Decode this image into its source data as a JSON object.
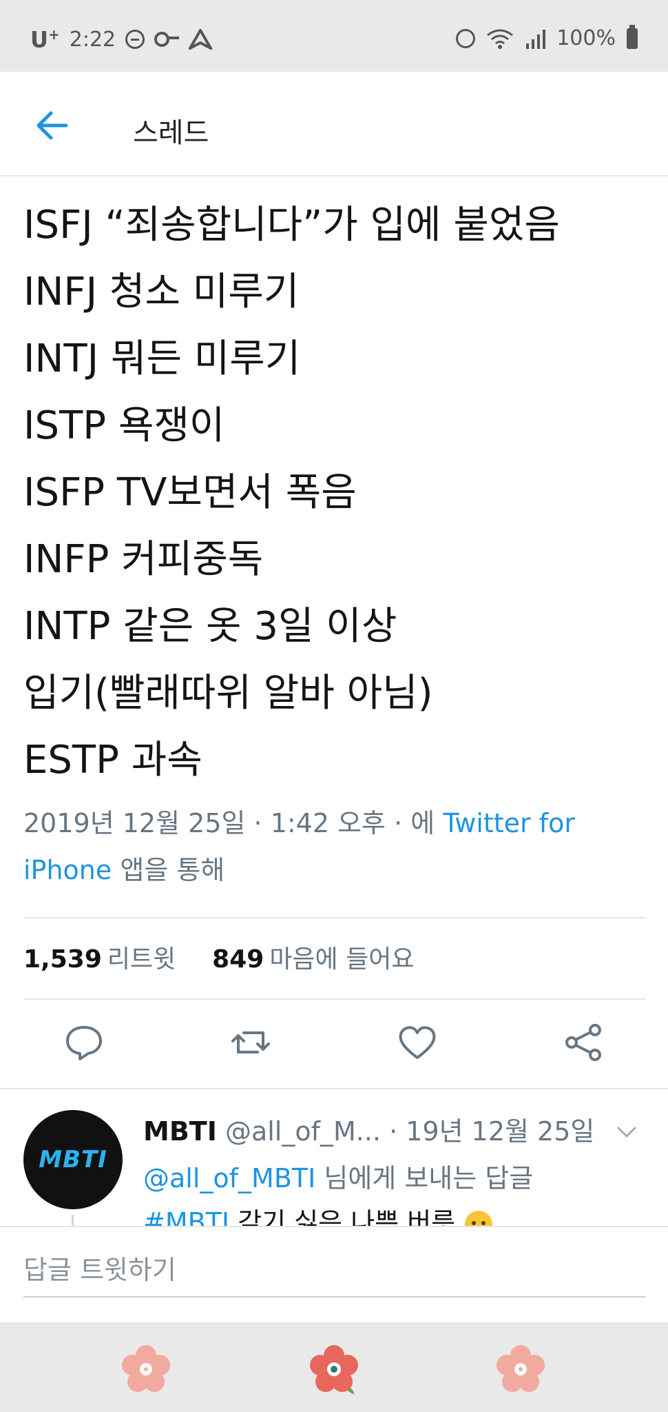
{
  "status_bar": {
    "carrier": "U",
    "carrier_sup": "+",
    "time": "2:22",
    "battery": "100%"
  },
  "header": {
    "title": "스레드"
  },
  "tweet": {
    "lines": [
      "ISFJ “죄송합니다”가 입에 붙었음",
      "INFJ 청소 미루기",
      "INTJ 뭐든 미루기",
      "ISTP 욕쟁이",
      "ISFP TV보면서 폭음",
      "INFP 커피중독",
      "INTP 같은 옷 3일 이상",
      "입기(빨래따위 알바 아님)",
      "ESTP 과속"
    ],
    "meta_date": "2019년 12월 25일 · 1:42 오후 · 에 ",
    "meta_source": "Twitter for iPhone",
    "meta_suffix": " 앱을 통해"
  },
  "stats": {
    "retweets_count": "1,539",
    "retweets_label": "리트윗",
    "likes_count": "849",
    "likes_label": "마음에 들어요"
  },
  "reply": {
    "avatar_text": "MBTI",
    "name": "MBTI",
    "handle": "@all_of_M...",
    "date": "· 19년 12월 25일",
    "mention": "@all_of_MBTI",
    "reply_to_suffix": " 님에게 보내는 답글",
    "hashtag": "#MBTI",
    "text_partial": " 갖기 싫은 나쁜 버릇"
  },
  "compose": {
    "placeholder": "답글 트윗하기"
  },
  "colors": {
    "link": "#1d94e0",
    "muted": "#677583",
    "status_bar_bg": "#e9e9e9"
  }
}
